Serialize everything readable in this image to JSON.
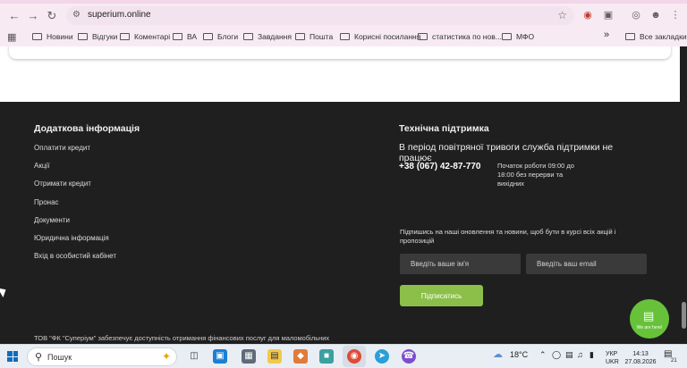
{
  "browser": {
    "url": "superium.online",
    "bookmarks": [
      {
        "label": "Новини"
      },
      {
        "label": "Відгуки"
      },
      {
        "label": "Коментарі"
      },
      {
        "label": "ВА"
      },
      {
        "label": "Блоги"
      },
      {
        "label": "Завдання"
      },
      {
        "label": "Пошта"
      },
      {
        "label": "Корисні посилання"
      },
      {
        "label": "статистика по нов..."
      },
      {
        "label": "МФО"
      }
    ],
    "overflow_label": "»",
    "all_bookmarks": "Все закладки"
  },
  "footer": {
    "info": {
      "title": "Додаткова інформація",
      "links": [
        "Оплатити кредит",
        "Акції",
        "Отримати кредит",
        "Пронас",
        "Документи",
        "Юридична інформація",
        "Вхід в особистий кабінет"
      ]
    },
    "support": {
      "title": "Технічна підтримка",
      "notice": "В період повітряної тривоги служба підтримки не працює",
      "phone": "+38 (067) 42-87-770",
      "hours": "Початок роботи 09:00 до 18:00 без перерви та вихідних"
    },
    "subscribe": {
      "text": "Підпишись на наші оновлення та новини, щоб бути в курсі всіх акцій і пропозицій",
      "name_placeholder": "Введіть ваше ім'я",
      "email_placeholder": "Введіть ваш email",
      "button": "Підписатись"
    },
    "legal": "ТОВ \"ФК \"Суперіум\" забезпечує доступність отримання фінансових послуг для маломобільних груп населення. Приміщення Товариства за адресою місцезнаходження"
  },
  "chat": {
    "label": "We are here!"
  },
  "taskbar": {
    "search": "Пошук",
    "weather": "18°C",
    "lang_top": "УКР",
    "lang_bottom": "UKR",
    "time": "14:13",
    "date": "27.08.2026",
    "notif_count": "21"
  },
  "colors": {
    "footer_bg": "#1f1f1f",
    "accent_green": "#8bbf4a",
    "chat_green": "#67c23a"
  }
}
